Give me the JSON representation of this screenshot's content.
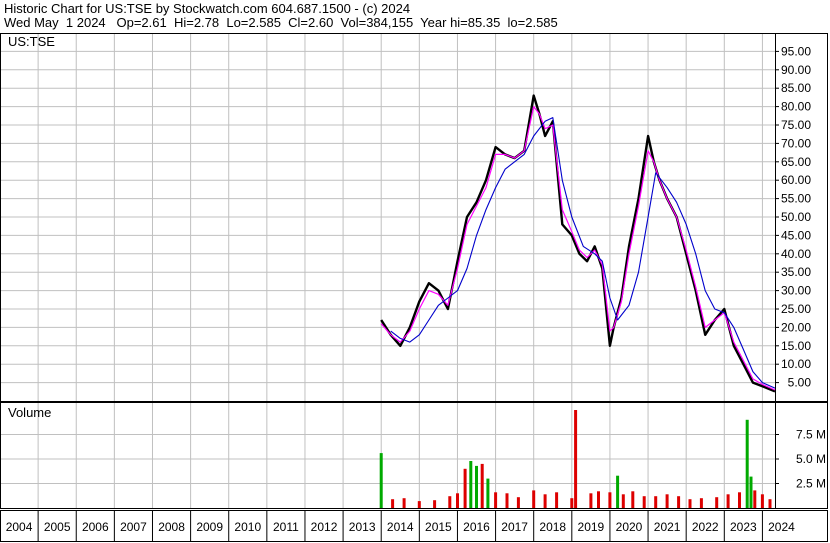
{
  "header": {
    "line1": "Historic Chart for US:TSE by Stockwatch.com 604.687.1500 - (c) 2024",
    "line2": "Wed May  1 2024   Op=2.61  Hi=2.78  Lo=2.585  Cl=2.60  Vol=384,155  Year hi=85.35  lo=2.585"
  },
  "colors": {
    "price": "#000000",
    "ma_short": "#ff00ff",
    "ma_long": "#0000cc",
    "vol_up": "#00aa00",
    "vol_down": "#dd0000",
    "grid": "#c0c0c0"
  },
  "chart_data": [
    {
      "type": "line",
      "label": "US:TSE",
      "ylim": [
        0,
        100
      ],
      "xlim": [
        2004,
        2024.33
      ],
      "y_ticks": [
        "95.00",
        "90.00",
        "85.00",
        "80.00",
        "75.00",
        "70.00",
        "65.00",
        "60.00",
        "55.00",
        "50.00",
        "45.00",
        "40.00",
        "35.00",
        "30.00",
        "25.00",
        "20.00",
        "15.00",
        "10.00",
        "5.00"
      ],
      "x_ticks": [
        "2004",
        "2005",
        "2006",
        "2007",
        "2008",
        "2009",
        "2010",
        "2011",
        "2012",
        "2013",
        "2014",
        "2015",
        "2016",
        "2017",
        "2018",
        "2019",
        "2020",
        "2021",
        "2022",
        "2023",
        "2024"
      ],
      "grid": true,
      "series": [
        {
          "name": "",
          "role": "price",
          "x": [
            2014.0,
            2014.25,
            2014.5,
            2014.75,
            2015.0,
            2015.25,
            2015.5,
            2015.75,
            2016.0,
            2016.25,
            2016.5,
            2016.75,
            2017.0,
            2017.25,
            2017.5,
            2017.75,
            2018.0,
            2018.15,
            2018.3,
            2018.5,
            2018.75,
            2019.0,
            2019.2,
            2019.4,
            2019.6,
            2019.8,
            2020.0,
            2020.1,
            2020.3,
            2020.5,
            2020.75,
            2021.0,
            2021.15,
            2021.3,
            2021.5,
            2021.75,
            2022.0,
            2022.25,
            2022.5,
            2022.75,
            2023.0,
            2023.25,
            2023.5,
            2023.75,
            2024.0,
            2024.33
          ],
          "values": [
            22,
            18,
            15,
            20,
            27,
            32,
            30,
            25,
            38,
            50,
            54,
            60,
            69,
            67,
            66,
            68,
            83,
            78,
            72,
            76,
            48,
            45,
            40,
            38,
            42,
            36,
            15,
            20,
            28,
            42,
            55,
            72,
            65,
            60,
            55,
            50,
            40,
            30,
            18,
            22,
            25,
            15,
            10,
            5,
            4,
            2.6
          ]
        },
        {
          "name": "",
          "role": "ma_short",
          "x": [
            2014.0,
            2014.25,
            2014.5,
            2014.75,
            2015.0,
            2015.25,
            2015.5,
            2015.75,
            2016.0,
            2016.25,
            2016.5,
            2016.75,
            2017.0,
            2017.25,
            2017.5,
            2017.75,
            2018.0,
            2018.15,
            2018.3,
            2018.5,
            2018.75,
            2019.0,
            2019.2,
            2019.4,
            2019.6,
            2019.8,
            2020.0,
            2020.1,
            2020.3,
            2020.5,
            2020.75,
            2021.0,
            2021.15,
            2021.3,
            2021.5,
            2021.75,
            2022.0,
            2022.25,
            2022.5,
            2022.75,
            2023.0,
            2023.25,
            2023.5,
            2023.75,
            2024.0,
            2024.33
          ],
          "values": [
            21,
            18,
            16,
            19,
            25,
            30,
            29,
            26,
            36,
            48,
            53,
            58,
            67,
            67,
            66,
            68,
            80,
            78,
            74,
            75,
            52,
            46,
            41,
            39,
            41,
            37,
            19,
            20,
            27,
            40,
            53,
            68,
            65,
            60,
            55,
            50,
            41,
            31,
            20,
            22,
            24,
            16,
            11,
            6,
            4.5,
            3
          ]
        },
        {
          "name": "",
          "role": "ma_long",
          "x": [
            2014.25,
            2014.5,
            2014.75,
            2015.0,
            2015.25,
            2015.5,
            2015.75,
            2016.0,
            2016.25,
            2016.5,
            2016.75,
            2017.0,
            2017.25,
            2017.5,
            2017.75,
            2018.0,
            2018.3,
            2018.5,
            2018.75,
            2019.0,
            2019.3,
            2019.6,
            2019.8,
            2020.0,
            2020.2,
            2020.5,
            2020.75,
            2021.0,
            2021.2,
            2021.5,
            2021.75,
            2022.0,
            2022.25,
            2022.5,
            2022.75,
            2023.0,
            2023.25,
            2023.5,
            2023.75,
            2024.0,
            2024.33
          ],
          "values": [
            19,
            17,
            16,
            18,
            22,
            26,
            28,
            30,
            36,
            45,
            52,
            58,
            63,
            65,
            67,
            72,
            76,
            77,
            60,
            50,
            42,
            40,
            38,
            28,
            22,
            26,
            35,
            50,
            62,
            58,
            54,
            48,
            40,
            30,
            25,
            24,
            20,
            14,
            8,
            5,
            3.5
          ]
        }
      ]
    },
    {
      "type": "bar",
      "label": "Volume",
      "y_ticks": [
        "7.5 M",
        "5.0 M",
        "2.5 M"
      ],
      "ylim": [
        0,
        10
      ],
      "unit": "M",
      "x": [
        2014.0,
        2014.3,
        2014.6,
        2015.0,
        2015.4,
        2015.8,
        2016.0,
        2016.2,
        2016.35,
        2016.5,
        2016.65,
        2016.8,
        2017.0,
        2017.3,
        2017.6,
        2018.0,
        2018.3,
        2018.6,
        2019.0,
        2019.1,
        2019.5,
        2019.7,
        2020.0,
        2020.2,
        2020.35,
        2020.6,
        2020.9,
        2021.2,
        2021.5,
        2021.8,
        2022.1,
        2022.4,
        2022.8,
        2023.1,
        2023.4,
        2023.6,
        2023.7,
        2023.8,
        2024.0,
        2024.2
      ],
      "values": [
        5.6,
        0.9,
        1.0,
        0.7,
        0.8,
        1.2,
        1.5,
        4.0,
        4.8,
        4.3,
        4.5,
        3.0,
        1.6,
        1.5,
        1.1,
        1.8,
        1.4,
        1.6,
        1.0,
        10.0,
        1.5,
        1.7,
        1.6,
        3.3,
        1.4,
        1.7,
        1.2,
        1.2,
        1.4,
        1.2,
        0.9,
        1.0,
        1.1,
        1.4,
        1.6,
        9.0,
        3.2,
        1.8,
        1.4,
        0.9
      ]
    }
  ]
}
